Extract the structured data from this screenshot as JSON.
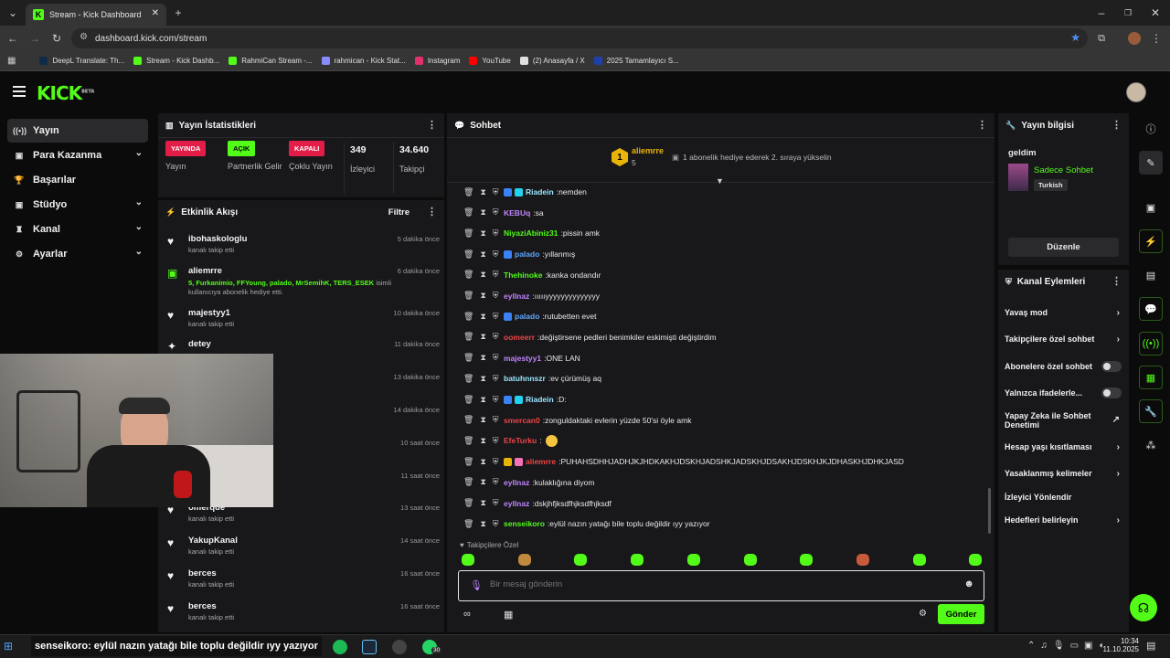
{
  "browser": {
    "tab_title": "Stream - Kick Dashboard",
    "url": "dashboard.kick.com/stream",
    "bookmarks": [
      {
        "label": "DeepL Translate: Th...",
        "color": "#0f2b46"
      },
      {
        "label": "Stream - Kick Dashb...",
        "color": "#53fc18"
      },
      {
        "label": "RahmiCan Stream -...",
        "color": "#53fc18"
      },
      {
        "label": "rahmican - Kick Stat...",
        "color": "#8a8aff"
      },
      {
        "label": "Instagram",
        "color": "#e1306c"
      },
      {
        "label": "YouTube",
        "color": "#ff0000"
      },
      {
        "label": "(2) Anasayfa / X",
        "color": "#e0e0e0"
      },
      {
        "label": "2025 Tamamlayıcı S...",
        "color": "#1e40af"
      }
    ]
  },
  "app": {
    "logo": "KICK",
    "logo_beta": "BETA"
  },
  "sidebar": {
    "items": [
      {
        "icon": "signal-icon",
        "glyph": "((•))",
        "label": "Yayın",
        "chevron": false,
        "active": true
      },
      {
        "icon": "money-icon",
        "glyph": "▣",
        "label": "Para Kazanma",
        "chevron": true,
        "active": false
      },
      {
        "icon": "trophy-icon",
        "glyph": "🏆",
        "label": "Başarılar",
        "chevron": false,
        "active": false
      },
      {
        "icon": "studio-icon",
        "glyph": "▣",
        "label": "Stüdyo",
        "chevron": true,
        "active": false
      },
      {
        "icon": "channel-icon",
        "glyph": "♜",
        "label": "Kanal",
        "chevron": true,
        "active": false
      },
      {
        "icon": "settings-icon",
        "glyph": "⚙",
        "label": "Ayarlar",
        "chevron": true,
        "active": false
      }
    ]
  },
  "stats": {
    "title": "Yayın İstatistikleri",
    "cells": [
      {
        "pill": "YAYINDA",
        "pill_color": "#e11d48",
        "label": "Yayın"
      },
      {
        "pill": "AÇIK",
        "pill_color": "#53fc18",
        "label": "Partnerlik Gelir"
      },
      {
        "pill": "KAPALI",
        "pill_color": "#e11d48",
        "label": "Çoklu Yayın"
      },
      {
        "value": "349",
        "label": "İzleyici"
      },
      {
        "value": "34.640",
        "label": "Takipçi"
      }
    ]
  },
  "activity": {
    "title": "Etkinlik Akışı",
    "filter_label": "Filtre",
    "items": [
      {
        "icon": "heart-icon",
        "name": "ibohaskologlu",
        "sub": "kanalı takip etti",
        "time": "5 dakika önce"
      },
      {
        "icon": "gift-icon",
        "name": "aliemrre",
        "gift_names": "5, Furkanimio, FFYoung, palado, MrSemihK, TERS_ESEK",
        "sub": "isimli kullanıcıya abonelik hediye etti.",
        "time": "6 dakika önce"
      },
      {
        "icon": "heart-icon",
        "name": "majestyy1",
        "sub": "kanalı takip etti",
        "time": "10 dakika önce"
      },
      {
        "icon": "sparkle-icon",
        "name": "detey",
        "sub": "",
        "time": "11 dakika önce"
      },
      {
        "icon": "heart-icon",
        "name": "",
        "sub": "",
        "time": "13 dakika önce"
      },
      {
        "icon": "heart-icon",
        "name": "",
        "sub": "",
        "time": "14 dakika önce"
      },
      {
        "icon": "heart-icon",
        "name": "",
        "sub": "",
        "time": "10 saat önce"
      },
      {
        "icon": "heart-icon",
        "name": "",
        "sub": "",
        "time": "11 saat önce"
      },
      {
        "icon": "heart-icon",
        "name": "ömerque",
        "sub": "kanalı takip etti",
        "time": "13 saat önce"
      },
      {
        "icon": "heart-icon",
        "name": "YakupKanal",
        "sub": "kanalı takip etti",
        "time": "14 saat önce"
      },
      {
        "icon": "heart-icon",
        "name": "berces",
        "sub": "kanalı takip etti",
        "time": "16 saat önce"
      },
      {
        "icon": "heart-icon",
        "name": "berces",
        "sub": "kanalı takip etti",
        "time": "16 saat önce"
      }
    ]
  },
  "chat": {
    "title": "Sohbet",
    "pinned_user": "aliemrre",
    "pinned_rank": "1",
    "pinned_count": "5",
    "pinned_text": "1 abonelik hediye ederek 2. sıraya yükselin",
    "messages": [
      {
        "user": "Riadein",
        "color": "#9ae6ff",
        "text": "nemden",
        "badges": [
          "#3b82f6",
          "#22d3ee"
        ]
      },
      {
        "user": "KEBUq",
        "color": "#c084fc",
        "text": "sa",
        "badges": []
      },
      {
        "user": "NiyaziAbiniz31",
        "color": "#53fc18",
        "text": "pissin amk",
        "badges": []
      },
      {
        "user": "palado",
        "color": "#60a5fa",
        "text": "yıllanmış",
        "badges": [
          "#3b82f6"
        ]
      },
      {
        "user": "Thehinoke",
        "color": "#53fc18",
        "text": "kanka ondandır",
        "badges": []
      },
      {
        "user": "eyllnaz",
        "color": "#c084fc",
        "text": "ıııııyyyyyyyyyyyyyy",
        "badges": []
      },
      {
        "user": "palado",
        "color": "#60a5fa",
        "text": "rutubetten evet",
        "badges": [
          "#3b82f6"
        ]
      },
      {
        "user": "oomeerr",
        "color": "#ef4444",
        "text": "değiştirsene pedleri benimkiler eskimişti değiştirdim",
        "badges": []
      },
      {
        "user": "majestyy1",
        "color": "#c084fc",
        "text": "ONE LAN",
        "badges": []
      },
      {
        "user": "batuhnnszr",
        "color": "#9ae6ff",
        "text": "ev çürümüş aq",
        "badges": []
      },
      {
        "user": "Riadein",
        "color": "#9ae6ff",
        "text": "D:",
        "badges": [
          "#3b82f6",
          "#22d3ee"
        ]
      },
      {
        "user": "smercan0",
        "color": "#ef4444",
        "text": "zonguldaktaki evlerin yüzde 50'si öyle amk",
        "badges": []
      },
      {
        "user": "EfeTurku",
        "color": "#ef4444",
        "text": "",
        "badges": [],
        "emote": true
      },
      {
        "user": "aliemrre",
        "color": "#ef4444",
        "text": "PUHAHSDHHJADHJKJHDKAKHJDSKHJADSHKJADSKHJDSAKHJDSKHJKJDHASKHJDHKJASD",
        "badges": [
          "#eab308",
          "#f472b6"
        ]
      },
      {
        "user": "eyllnaz",
        "color": "#c084fc",
        "text": "kulaklığına diyom",
        "badges": []
      },
      {
        "user": "eyllnaz",
        "color": "#c084fc",
        "text": "dskjhfjksdfhjksdfhjksdf",
        "badges": []
      },
      {
        "user": "senseikoro",
        "color": "#53fc18",
        "text": "eylül nazın yatağı bile toplu değildir ıyy yazıyor",
        "badges": []
      }
    ],
    "followers_only": "Takipçilere Özel",
    "input_placeholder": "Bir mesaj gönderin",
    "send_label": "Gönder"
  },
  "stream_info": {
    "title": "Yayın bilgisi",
    "stream_title": "geldim",
    "category": "Sadece Sohbet",
    "language": "Turkish",
    "edit_label": "Düzenle"
  },
  "channel_actions": {
    "title": "Kanal Eylemleri",
    "items": [
      {
        "label": "Yavaş mod",
        "control": "chevron"
      },
      {
        "label": "Takipçilere özel sohbet",
        "control": "chevron"
      },
      {
        "label": "Abonelere özel sohbet",
        "control": "toggle"
      },
      {
        "label": "Yalnızca ifadelerle...",
        "control": "toggle"
      },
      {
        "label": "Yapay Zeka ile Sohbet Denetimi",
        "control": "external"
      },
      {
        "label": "Hesap yaşı kısıtlaması",
        "control": "chevron"
      },
      {
        "label": "Yasaklanmış kelimeler",
        "control": "chevron"
      },
      {
        "label": "İzleyici Yönlendir",
        "control": "none"
      },
      {
        "label": "Hedefleri belirleyin",
        "control": "chevron"
      }
    ]
  },
  "overlay": {
    "caption": "senseikoro: eylül nazın yatağı bile toplu değildir ıyy yazıyor"
  },
  "taskbar": {
    "time": "10:34",
    "date": "11.10.2025",
    "badge": "30"
  }
}
